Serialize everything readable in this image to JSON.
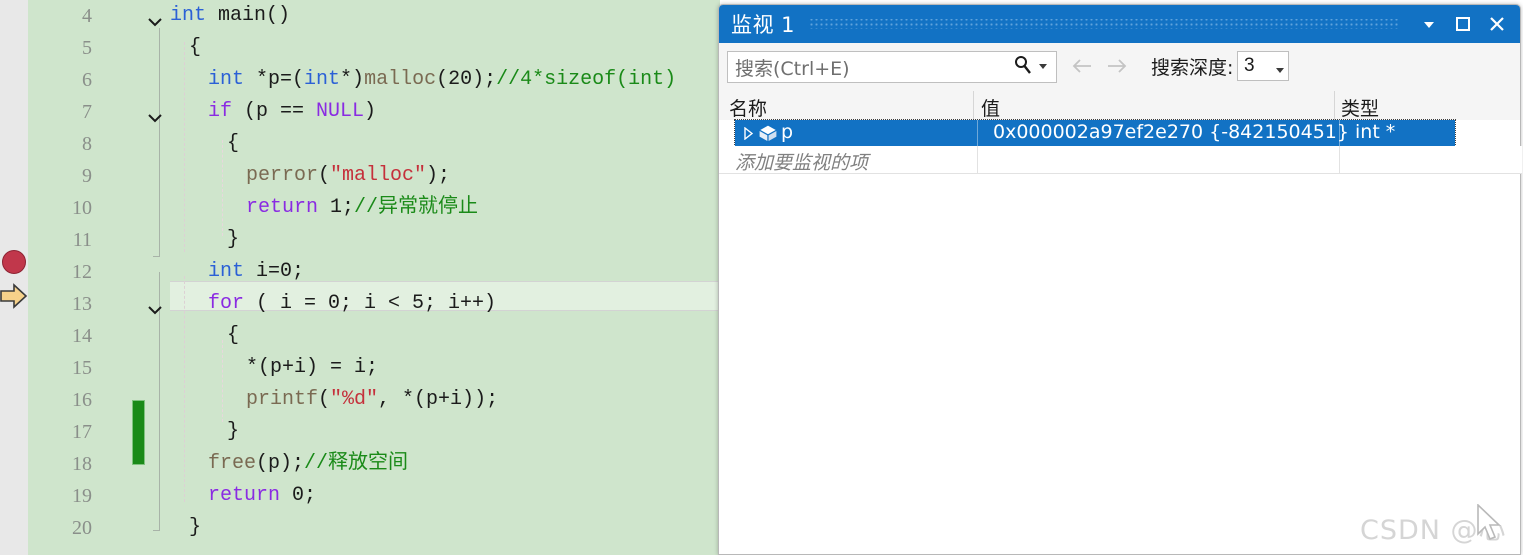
{
  "editor": {
    "first_line_number": 4,
    "breakpoint_line": 12,
    "execution_pointer_line": 13,
    "current_line": 13,
    "lines": [
      {
        "num": "4",
        "tokens": [
          {
            "t": "int",
            "c": "kw"
          },
          {
            "t": " main()",
            "c": "pl"
          }
        ],
        "chevron": "collapse-down"
      },
      {
        "num": "5",
        "tokens": [
          {
            "t": "{",
            "c": "pl"
          }
        ],
        "indent": 1
      },
      {
        "num": "6",
        "tokens": [
          {
            "t": "int",
            "c": "kw"
          },
          {
            "t": " *p=(",
            "c": "pl"
          },
          {
            "t": "int",
            "c": "kw"
          },
          {
            "t": "*)",
            "c": "pl"
          },
          {
            "t": "malloc",
            "c": "fn"
          },
          {
            "t": "(20);",
            "c": "pl"
          },
          {
            "t": "//4*sizeof(int)",
            "c": "cmt"
          }
        ],
        "indent": 2
      },
      {
        "num": "7",
        "tokens": [
          {
            "t": "if",
            "c": "kw2"
          },
          {
            "t": " (p == ",
            "c": "pl"
          },
          {
            "t": "NULL",
            "c": "mac"
          },
          {
            "t": ")",
            "c": "pl"
          }
        ],
        "indent": 2,
        "chevron": "collapse-down"
      },
      {
        "num": "8",
        "tokens": [
          {
            "t": "{",
            "c": "pl"
          }
        ],
        "indent": 3
      },
      {
        "num": "9",
        "tokens": [
          {
            "t": "perror",
            "c": "fn"
          },
          {
            "t": "(",
            "c": "pl"
          },
          {
            "t": "\"malloc\"",
            "c": "str"
          },
          {
            "t": ");",
            "c": "pl"
          }
        ],
        "indent": 4
      },
      {
        "num": "10",
        "tokens": [
          {
            "t": "return",
            "c": "kw2"
          },
          {
            "t": " 1;",
            "c": "pl"
          },
          {
            "t": "//异常就停止",
            "c": "cmt"
          }
        ],
        "indent": 4
      },
      {
        "num": "11",
        "tokens": [
          {
            "t": "}",
            "c": "pl"
          }
        ],
        "indent": 3
      },
      {
        "num": "12",
        "tokens": [
          {
            "t": "int",
            "c": "kw"
          },
          {
            "t": " i=0;",
            "c": "pl"
          }
        ],
        "indent": 2
      },
      {
        "num": "13",
        "tokens": [
          {
            "t": "for",
            "c": "kw2"
          },
          {
            "t": " ( i = 0; i < 5; i++)",
            "c": "pl"
          }
        ],
        "indent": 2,
        "chevron": "collapse-down",
        "current": true
      },
      {
        "num": "14",
        "tokens": [
          {
            "t": "{",
            "c": "pl"
          }
        ],
        "indent": 3
      },
      {
        "num": "15",
        "tokens": [
          {
            "t": "*(p+i) = i;",
            "c": "pl"
          }
        ],
        "indent": 4
      },
      {
        "num": "16",
        "tokens": [
          {
            "t": "printf",
            "c": "fn"
          },
          {
            "t": "(",
            "c": "pl"
          },
          {
            "t": "\"%d\"",
            "c": "str"
          },
          {
            "t": ", *(p+i));",
            "c": "pl"
          }
        ],
        "indent": 4
      },
      {
        "num": "17",
        "tokens": [
          {
            "t": "}",
            "c": "pl"
          }
        ],
        "indent": 3
      },
      {
        "num": "18",
        "tokens": [
          {
            "t": "free",
            "c": "fn"
          },
          {
            "t": "(p);",
            "c": "pl"
          },
          {
            "t": "//释放空间",
            "c": "cmt"
          }
        ],
        "indent": 2
      },
      {
        "num": "19",
        "tokens": [
          {
            "t": "return",
            "c": "kw2"
          },
          {
            "t": " 0;",
            "c": "pl"
          }
        ],
        "indent": 2
      },
      {
        "num": "20",
        "tokens": [
          {
            "t": "}",
            "c": "pl"
          }
        ],
        "indent": 1
      }
    ],
    "colors": {
      "background": "#cfe5cc",
      "keyword": "#2b60d6",
      "control_keyword": "#8a2be2",
      "function": "#7a6a52",
      "string": "#c5303b",
      "comment": "#1a8a18",
      "line_number": "#8a8f8a",
      "change_bar_saved": "#1a8a18",
      "breakpoint": "#c1374b"
    }
  },
  "watch_window": {
    "title": "监视 1",
    "title_bar": {
      "dropdown_label": "▾",
      "maximize_label": "□",
      "close_label": "✕",
      "background": "#1272c4"
    },
    "toolbar": {
      "search_placeholder": "搜索(Ctrl+E)",
      "search_value": "",
      "search_icon": "search-icon",
      "search_dropdown": "▾",
      "back_arrow": "←",
      "forward_arrow": "→",
      "depth_label": "搜索深度:",
      "depth_value": "3",
      "depth_dropdown": "▾"
    },
    "columns": [
      "名称",
      "值",
      "类型"
    ],
    "rows": [
      {
        "expander": "▸",
        "icon": "object-box-icon",
        "name": "p",
        "value": "0x000002a97ef2e270 {-842150451}",
        "type": "int *",
        "selected": true
      }
    ],
    "add_row_placeholder": "添加要监视的项"
  },
  "watermark": {
    "text": "CSDN @心"
  }
}
